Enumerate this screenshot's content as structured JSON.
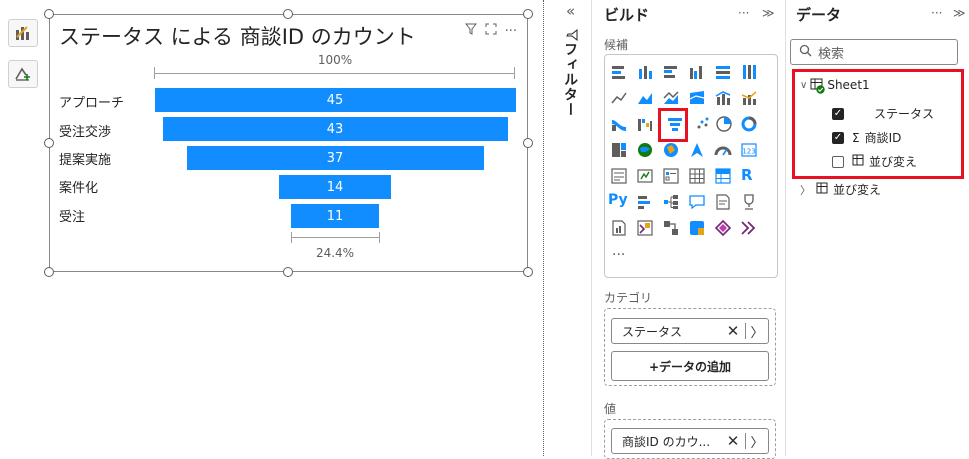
{
  "visual": {
    "title": "ステータス による 商談ID のカウント",
    "top_percent": "100%",
    "bottom_percent": "24.4%",
    "bar_color": "#118dff"
  },
  "chart_data": {
    "type": "funnel",
    "title": "ステータス による 商談ID のカウント",
    "categories": [
      "アプローチ",
      "受注交渉",
      "提案実施",
      "案件化",
      "受注"
    ],
    "values": [
      45,
      43,
      37,
      14,
      11
    ],
    "first_stage_percent": "100%",
    "last_stage_percent": "24.4%"
  },
  "filter_pane": {
    "collapse_icon": "double-chevron-left-icon",
    "label": "フィルター"
  },
  "build_pane": {
    "title": "ビルド",
    "more": "···",
    "expand": "≫",
    "candidates_label": "候補",
    "more_visuals": "...",
    "category_label": "カテゴリ",
    "category_field": "ステータス",
    "add_data_button": "+データの追加",
    "value_label": "値",
    "value_field": "商談ID のカウ...",
    "remove_glyph": "✕",
    "chevron_glyph": "〉"
  },
  "data_pane": {
    "title": "データ",
    "more": "···",
    "expand": "≫",
    "search_placeholder": "検索",
    "table_name": "Sheet1",
    "fields": [
      {
        "name": "ステータス",
        "checked": true
      },
      {
        "name": "商談ID",
        "checked": true,
        "sigma": "Σ"
      },
      {
        "name": "並び変え",
        "checked": false
      }
    ],
    "other_table": "並び変え",
    "highlight_color": "#e81123"
  }
}
